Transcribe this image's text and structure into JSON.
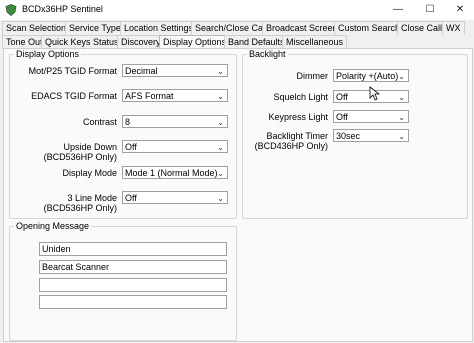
{
  "window": {
    "title": "BCDx36HP Sentinel"
  },
  "tabs_row1": [
    {
      "label": "Scan Selection"
    },
    {
      "label": "Service Types"
    },
    {
      "label": "Location Settings"
    },
    {
      "label": "Search/Close Call"
    },
    {
      "label": "Broadcast Screen"
    },
    {
      "label": "Custom Search"
    },
    {
      "label": "Close Call"
    },
    {
      "label": "WX"
    }
  ],
  "tabs_row2": [
    {
      "label": "Tone Out"
    },
    {
      "label": "Quick Keys Status"
    },
    {
      "label": "Discovery"
    },
    {
      "label": "Display Options"
    },
    {
      "label": "Band Defaults"
    },
    {
      "label": "Miscellaneous"
    }
  ],
  "display_options": {
    "title": "Display Options",
    "mot_label": "Mot/P25 TGID Format",
    "mot_value": "Decimal",
    "edacs_label": "EDACS TGID Format",
    "edacs_value": "AFS Format",
    "contrast_label": "Contrast",
    "contrast_value": "8",
    "upside_label1": "Upside Down",
    "upside_label2": "(BCD536HP Only)",
    "upside_value": "Off",
    "mode_label": "Display Mode",
    "mode_value": "Mode 1 (Normal Mode)",
    "line3_label1": "3 Line Mode",
    "line3_label2": "(BCD536HP Only)",
    "line3_value": "Off"
  },
  "backlight": {
    "title": "Backlight",
    "dimmer_label": "Dimmer",
    "dimmer_value": "Polarity +(Auto)",
    "squelch_label": "Squelch Light",
    "squelch_value": "Off",
    "keypress_label": "Keypress Light",
    "keypress_value": "Off",
    "timer_label1": "Backlight Timer",
    "timer_label2": "(BCD436HP Only)",
    "timer_value": "30sec"
  },
  "opening_message": {
    "title": "Opening Message",
    "lines": [
      "Uniden",
      "Bearcat Scanner",
      "",
      ""
    ]
  }
}
